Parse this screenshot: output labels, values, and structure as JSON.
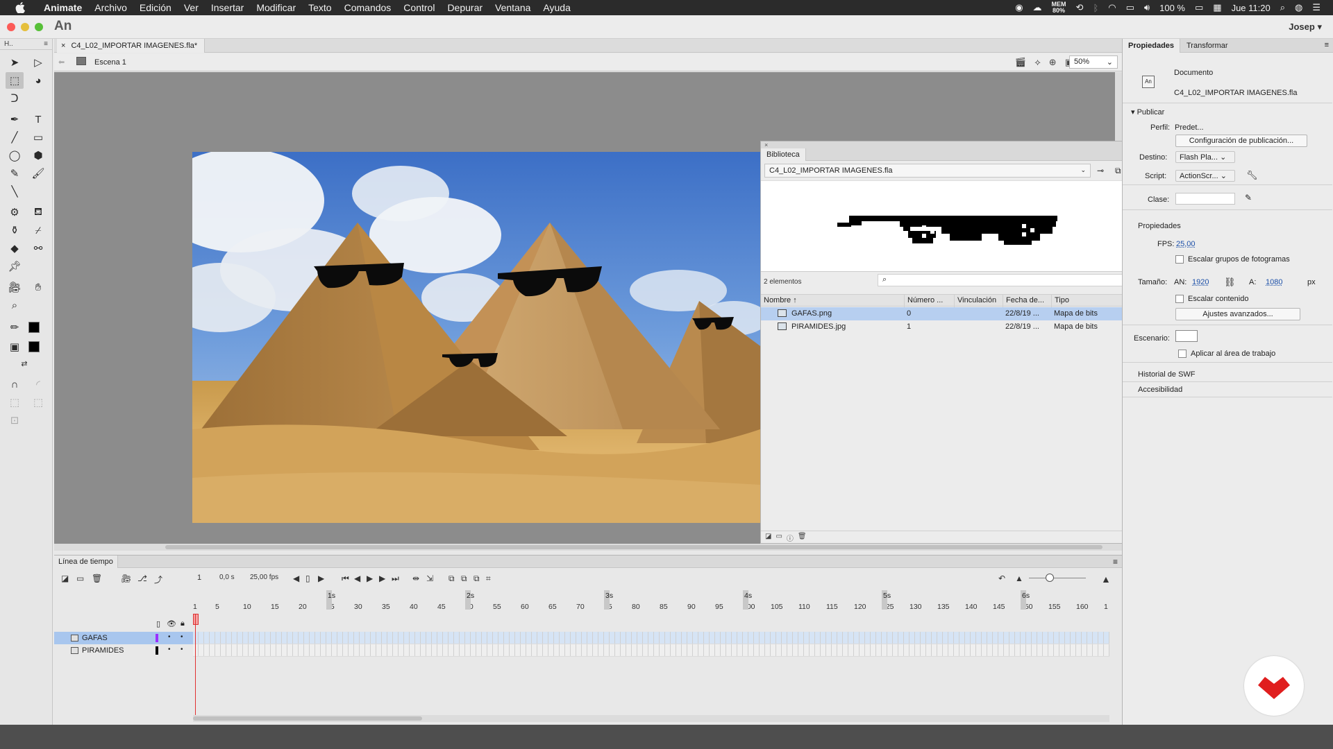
{
  "menubar": {
    "app_name": "Animate",
    "menus": [
      "Archivo",
      "Edición",
      "Ver",
      "Insertar",
      "Modificar",
      "Texto",
      "Comandos",
      "Control",
      "Depurar",
      "Ventana",
      "Ayuda"
    ],
    "status": {
      "mem_label": "MEM",
      "mem_value": "80%",
      "battery": "100 %",
      "clock": "Jue 11:20"
    }
  },
  "window": {
    "app_logo": "An",
    "user": "Josep",
    "user_arrow": "▾",
    "tools_header": "H..",
    "doc_tab": "C4_L02_IMPORTAR IMAGENES.fla*",
    "scene": "Escena 1",
    "zoom": "50%"
  },
  "library": {
    "top_close": "×",
    "tab": "Biblioteca",
    "file": "C4_L02_IMPORTAR IMAGENES.fla",
    "count": "2 elementos",
    "columns": [
      "Nombre",
      "Número ...",
      "Vinculación",
      "Fecha de...",
      "Tipo"
    ],
    "items": [
      {
        "name": "GAFAS.png",
        "number": "0",
        "link": "",
        "date": "22/8/19 ...",
        "type": "Mapa de bits"
      },
      {
        "name": "PIRAMIDES.jpg",
        "number": "1",
        "link": "",
        "date": "22/8/19 ...",
        "type": "Mapa de bits"
      }
    ]
  },
  "properties": {
    "tabs": [
      "Propiedades",
      "Transformar"
    ],
    "doc_label": "Documento",
    "doc_name": "C4_L02_IMPORTAR IMAGENES.fla",
    "publish_header": "Publicar",
    "profile_label": "Perfil:",
    "profile_value": "Predet...",
    "publish_settings_button": "Configuración de publicación...",
    "target_label": "Destino:",
    "target_value": "Flash Pla...",
    "script_label": "Script:",
    "script_value": "ActionScr...",
    "class_label": "Clase:",
    "props_header": "Propiedades",
    "fps_label": "FPS:",
    "fps_value": "25,00",
    "scale_frames_label": "Escalar grupos de fotogramas",
    "size_label": "Tamaño:",
    "width_label": "AN:",
    "width_value": "1920",
    "height_label": "A:",
    "height_value": "1080",
    "unit": "px",
    "scale_content_label": "Escalar contenido",
    "advanced_button": "Ajustes avanzados...",
    "stage_label": "Escenario:",
    "apply_workspace_label": "Aplicar al área de trabajo",
    "swf_history": "Historial de SWF",
    "accessibility": "Accesibilidad"
  },
  "timeline": {
    "tab": "Línea de tiempo",
    "frame": "1",
    "time": "0,0 s",
    "fps": "25,00 fps",
    "seconds": [
      "1s",
      "2s",
      "3s",
      "4s",
      "5s",
      "6s"
    ],
    "frame_ticks": [
      "1",
      "5",
      "10",
      "15",
      "20",
      "25",
      "30",
      "35",
      "40",
      "45",
      "50",
      "55",
      "60",
      "65",
      "70",
      "75",
      "80",
      "85",
      "90",
      "95",
      "100",
      "105",
      "110",
      "115",
      "120",
      "125",
      "130",
      "135",
      "140",
      "145",
      "150",
      "155",
      "160",
      "1"
    ],
    "layers": [
      {
        "name": "GAFAS",
        "color": "#9b30ff"
      },
      {
        "name": "PIRAMIDES",
        "color": "#000000"
      }
    ]
  },
  "colors": {
    "selection": "#b7cff0",
    "layer_selection": "#a8c6ee",
    "playhead": "#e03030",
    "badge_red": "#e01e1e"
  }
}
